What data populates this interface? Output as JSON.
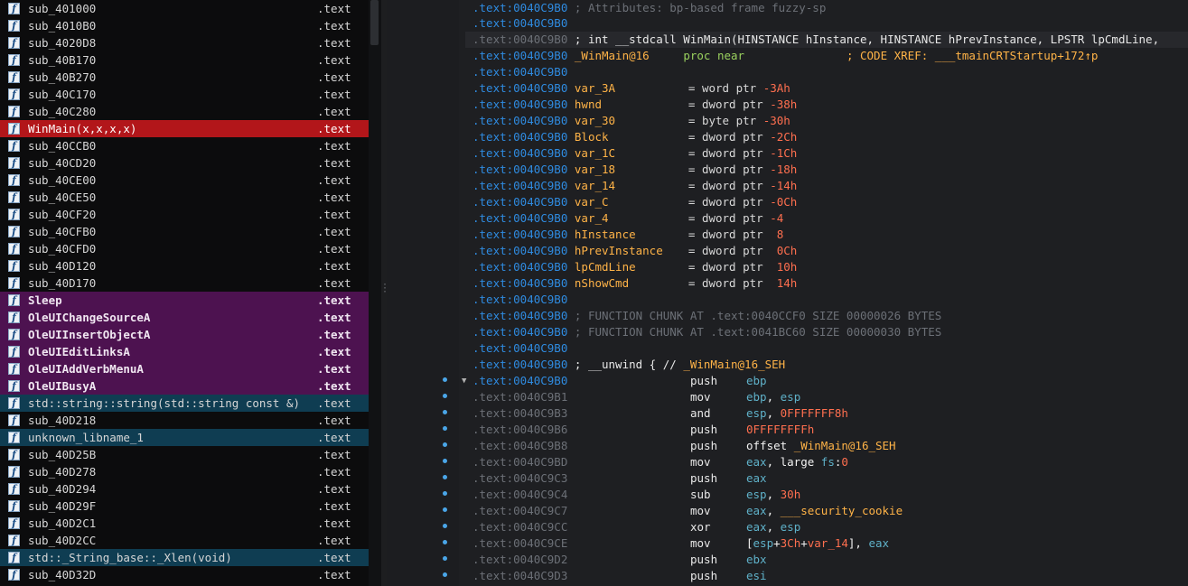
{
  "functions": [
    {
      "name": "sub_401000",
      "segment": ".text",
      "kind": "normal"
    },
    {
      "name": "sub_4010B0",
      "segment": ".text",
      "kind": "normal"
    },
    {
      "name": "sub_4020D8",
      "segment": ".text",
      "kind": "normal"
    },
    {
      "name": "sub_40B170",
      "segment": ".text",
      "kind": "normal"
    },
    {
      "name": "sub_40B270",
      "segment": ".text",
      "kind": "normal"
    },
    {
      "name": "sub_40C170",
      "segment": ".text",
      "kind": "normal"
    },
    {
      "name": "sub_40C280",
      "segment": ".text",
      "kind": "normal"
    },
    {
      "name": "WinMain(x,x,x,x)",
      "segment": ".text",
      "kind": "cur"
    },
    {
      "name": "sub_40CCB0",
      "segment": ".text",
      "kind": "normal"
    },
    {
      "name": "sub_40CD20",
      "segment": ".text",
      "kind": "normal"
    },
    {
      "name": "sub_40CE00",
      "segment": ".text",
      "kind": "normal"
    },
    {
      "name": "sub_40CE50",
      "segment": ".text",
      "kind": "normal"
    },
    {
      "name": "sub_40CF20",
      "segment": ".text",
      "kind": "normal"
    },
    {
      "name": "sub_40CFB0",
      "segment": ".text",
      "kind": "normal"
    },
    {
      "name": "sub_40CFD0",
      "segment": ".text",
      "kind": "normal"
    },
    {
      "name": "sub_40D120",
      "segment": ".text",
      "kind": "normal"
    },
    {
      "name": "sub_40D170",
      "segment": ".text",
      "kind": "normal"
    },
    {
      "name": "Sleep",
      "segment": ".text",
      "kind": "imp"
    },
    {
      "name": "OleUIChangeSourceA",
      "segment": ".text",
      "kind": "imp"
    },
    {
      "name": "OleUIInsertObjectA",
      "segment": ".text",
      "kind": "imp"
    },
    {
      "name": "OleUIEditLinksA",
      "segment": ".text",
      "kind": "imp"
    },
    {
      "name": "OleUIAddVerbMenuA",
      "segment": ".text",
      "kind": "imp"
    },
    {
      "name": "OleUIBusyA",
      "segment": ".text",
      "kind": "imp"
    },
    {
      "name": "std::string::string(std::string const &)",
      "segment": ".text",
      "kind": "lib"
    },
    {
      "name": "sub_40D218",
      "segment": ".text",
      "kind": "normal"
    },
    {
      "name": "unknown_libname_1",
      "segment": ".text",
      "kind": "lib"
    },
    {
      "name": "sub_40D25B",
      "segment": ".text",
      "kind": "normal"
    },
    {
      "name": "sub_40D278",
      "segment": ".text",
      "kind": "normal"
    },
    {
      "name": "sub_40D294",
      "segment": ".text",
      "kind": "normal"
    },
    {
      "name": "sub_40D29F",
      "segment": ".text",
      "kind": "normal"
    },
    {
      "name": "sub_40D2C1",
      "segment": ".text",
      "kind": "normal"
    },
    {
      "name": "sub_40D2CC",
      "segment": ".text",
      "kind": "normal"
    },
    {
      "name": "std::_String_base::_Xlen(void)",
      "segment": ".text",
      "kind": "lib"
    },
    {
      "name": "sub_40D32D",
      "segment": ".text",
      "kind": "normal"
    }
  ],
  "disasm": {
    "comment_attrs": "; Attributes: bp-based frame fuzzy-sp",
    "prototype": "; int __stdcall WinMain(HINSTANCE hInstance, HINSTANCE hPrevInstance, LPSTR lpCmdLine,",
    "proc_name": "_WinMain@16",
    "proc_kw": "proc near",
    "xref_prefix": "; CODE XREF: ",
    "xref_target": "___tmainCRTStartup+172",
    "xref_suffix": "↑p",
    "chunk1": "; FUNCTION CHUNK AT .text:0040CCF0 SIZE 00000026 BYTES",
    "chunk2": "; FUNCTION CHUNK AT .text:0041BC60 SIZE 00000030 BYTES",
    "unwind_prefix": "; __unwind { // ",
    "unwind_target": "_WinMain@16_SEH",
    "locals": [
      {
        "addr": ".text:0040C9B0",
        "name": "var_3A",
        "type": "= word ptr",
        "off": "-3Ah"
      },
      {
        "addr": ".text:0040C9B0",
        "name": "hwnd",
        "type": "= dword ptr",
        "off": "-38h"
      },
      {
        "addr": ".text:0040C9B0",
        "name": "var_30",
        "type": "= byte ptr",
        "off": "-30h"
      },
      {
        "addr": ".text:0040C9B0",
        "name": "Block",
        "type": "= dword ptr",
        "off": "-2Ch"
      },
      {
        "addr": ".text:0040C9B0",
        "name": "var_1C",
        "type": "= dword ptr",
        "off": "-1Ch"
      },
      {
        "addr": ".text:0040C9B0",
        "name": "var_18",
        "type": "= dword ptr",
        "off": "-18h"
      },
      {
        "addr": ".text:0040C9B0",
        "name": "var_14",
        "type": "= dword ptr",
        "off": "-14h"
      },
      {
        "addr": ".text:0040C9B0",
        "name": "var_C",
        "type": "= dword ptr",
        "off": "-0Ch"
      },
      {
        "addr": ".text:0040C9B0",
        "name": "var_4",
        "type": "= dword ptr",
        "off": "-4"
      },
      {
        "addr": ".text:0040C9B0",
        "name": "hInstance",
        "type": "= dword ptr",
        "off": " 8"
      },
      {
        "addr": ".text:0040C9B0",
        "name": "hPrevInstance",
        "type": "= dword ptr",
        "off": " 0Ch"
      },
      {
        "addr": ".text:0040C9B0",
        "name": "lpCmdLine",
        "type": "= dword ptr",
        "off": " 10h"
      },
      {
        "addr": ".text:0040C9B0",
        "name": "nShowCmd",
        "type": "= dword ptr",
        "off": " 14h"
      }
    ],
    "addr_main": ".text:0040C9B0",
    "instructions": [
      {
        "addr": ".text:0040C9B0",
        "mn": "push",
        "parts": [
          [
            "r",
            "ebp"
          ]
        ]
      },
      {
        "addr": ".text:0040C9B1",
        "mn": "mov",
        "parts": [
          [
            "r",
            "ebp"
          ],
          [
            "op",
            ", "
          ],
          [
            "r",
            "esp"
          ]
        ]
      },
      {
        "addr": ".text:0040C9B3",
        "mn": "and",
        "parts": [
          [
            "r",
            "esp"
          ],
          [
            "op",
            ", "
          ],
          [
            "n",
            "0FFFFFFF8h"
          ]
        ]
      },
      {
        "addr": ".text:0040C9B6",
        "mn": "push",
        "parts": [
          [
            "n",
            "0FFFFFFFFh"
          ]
        ]
      },
      {
        "addr": ".text:0040C9B8",
        "mn": "push",
        "parts": [
          [
            "op",
            "offset "
          ],
          [
            "xr",
            "_WinMain@16_SEH"
          ]
        ]
      },
      {
        "addr": ".text:0040C9BD",
        "mn": "mov",
        "parts": [
          [
            "r",
            "eax"
          ],
          [
            "op",
            ", large "
          ],
          [
            "r",
            "fs"
          ],
          [
            "op",
            ":"
          ],
          [
            "n",
            "0"
          ]
        ]
      },
      {
        "addr": ".text:0040C9C3",
        "mn": "push",
        "parts": [
          [
            "r",
            "eax"
          ]
        ]
      },
      {
        "addr": ".text:0040C9C4",
        "mn": "sub",
        "parts": [
          [
            "r",
            "esp"
          ],
          [
            "op",
            ", "
          ],
          [
            "n",
            "30h"
          ]
        ]
      },
      {
        "addr": ".text:0040C9C7",
        "mn": "mov",
        "parts": [
          [
            "r",
            "eax"
          ],
          [
            "op",
            ", "
          ],
          [
            "xr",
            "___security_cookie"
          ]
        ]
      },
      {
        "addr": ".text:0040C9CC",
        "mn": "xor",
        "parts": [
          [
            "r",
            "eax"
          ],
          [
            "op",
            ", "
          ],
          [
            "r",
            "esp"
          ]
        ]
      },
      {
        "addr": ".text:0040C9CE",
        "mn": "mov",
        "parts": [
          [
            "op",
            "["
          ],
          [
            "r",
            "esp"
          ],
          [
            "op",
            "+"
          ],
          [
            "n",
            "3Ch"
          ],
          [
            "op",
            "+"
          ],
          [
            "n",
            "var_14"
          ],
          [
            "op",
            "], "
          ],
          [
            "r",
            "eax"
          ]
        ]
      },
      {
        "addr": ".text:0040C9D2",
        "mn": "push",
        "parts": [
          [
            "r",
            "ebx"
          ]
        ]
      },
      {
        "addr": ".text:0040C9D3",
        "mn": "push",
        "parts": [
          [
            "r",
            "esi"
          ]
        ]
      }
    ],
    "colors": {
      "accent_address": "#2f8be0",
      "current_function": "#b2161a",
      "imports": "#4d1250",
      "library": "#0f3d52"
    }
  }
}
